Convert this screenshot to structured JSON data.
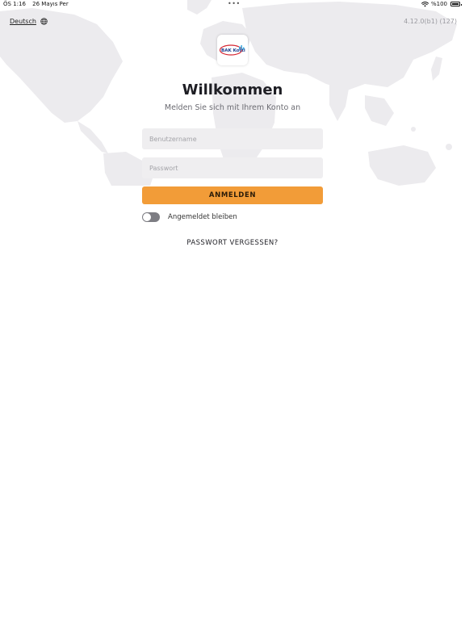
{
  "status_bar": {
    "time": "ÖS 1:16",
    "date": "26 Mayıs Per",
    "dots": "•••",
    "battery_text": "%100"
  },
  "top_bar": {
    "language": "Deutsch",
    "version": "4.12.0(b1) (127)"
  },
  "login": {
    "title": "Willkommen",
    "subtitle": "Melden Sie sich mit Ihrem Konto an",
    "username_placeholder": "Benutzername",
    "password_placeholder": "Passwort",
    "submit_label": "ANMELDEN",
    "remember_label": "Angemeldet bleiben",
    "remember_on": false,
    "forgot_label": "PASSWORT VERGESSEN?"
  },
  "logo_text": "BAK Kotti",
  "colors": {
    "accent": "#f29c38",
    "field_background": "#efeef0",
    "map": "#ecebee",
    "toggle_off": "#7d7d83"
  },
  "icons": {
    "language": "globe-icon",
    "wifi": "wifi-icon",
    "battery": "battery-icon"
  }
}
